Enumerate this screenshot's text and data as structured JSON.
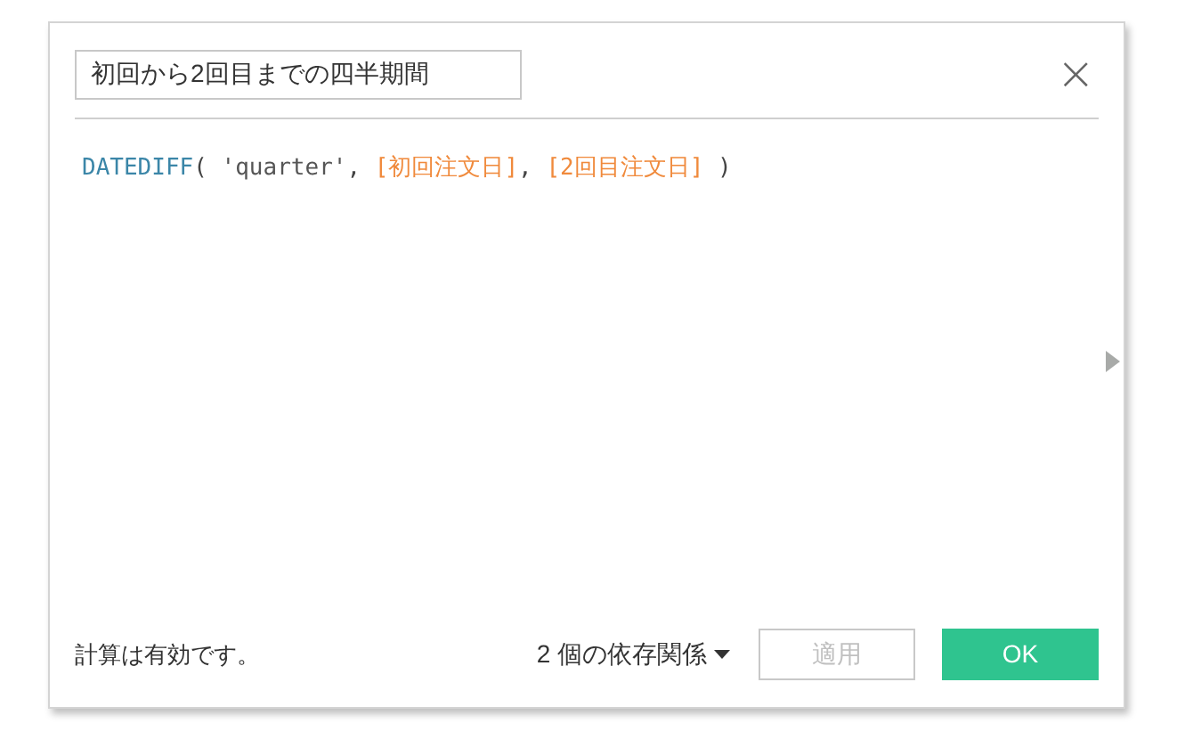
{
  "name_field": {
    "value": "初回から2回目までの四半期間"
  },
  "close": "×",
  "formula": [
    {
      "kind": "function",
      "text": "DATEDIFF"
    },
    {
      "kind": "punct",
      "text": "( "
    },
    {
      "kind": "string",
      "text": "'quarter'"
    },
    {
      "kind": "punct",
      "text": ", "
    },
    {
      "kind": "field",
      "text": "[初回注文日]"
    },
    {
      "kind": "punct",
      "text": ", "
    },
    {
      "kind": "field",
      "text": "[2回目注文日]"
    },
    {
      "kind": "punct",
      "text": " )"
    }
  ],
  "status": "計算は有効です。",
  "dependencies": "2 個の依存関係",
  "buttons": [
    {
      "label": "適用",
      "kind": "secondary",
      "disabled": true
    },
    {
      "label": "OK",
      "kind": "primary",
      "disabled": false
    }
  ]
}
